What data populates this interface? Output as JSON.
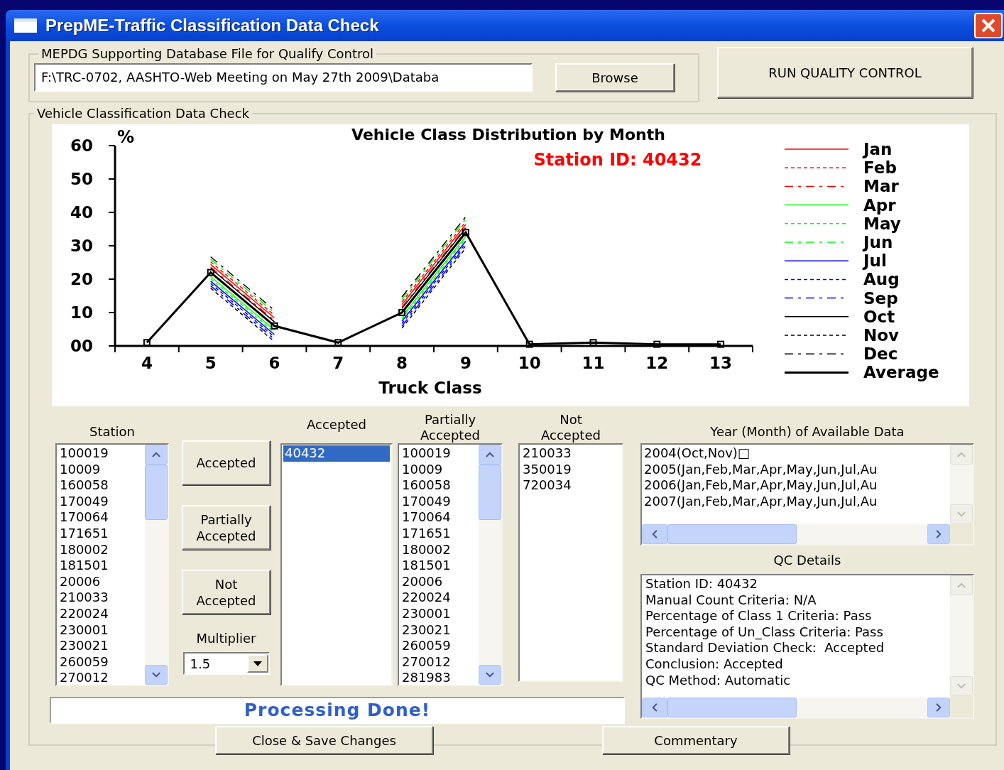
{
  "window": {
    "title": "PrepME-Traffic Classification Data Check"
  },
  "database_group": {
    "legend": "MEPDG Supporting Database File for Qualify Control",
    "file_path": "F:\\TRC-0702, AASHTO-Web Meeting on May 27th 2009\\Databa",
    "browse_button": "Browse"
  },
  "run_button": "RUN QUALITY CONTROL",
  "check_group": {
    "legend": "Vehicle Classification Data Check",
    "chart_data": {
      "type": "line",
      "title": "Vehicle Class Distribution by Month",
      "xlabel": "Truck Class",
      "ylabel": "%",
      "categories": [
        "4",
        "5",
        "6",
        "7",
        "8",
        "9",
        "10",
        "11",
        "12",
        "13"
      ],
      "ylim": [
        0,
        60
      ],
      "yticks": [
        {
          "value": 0,
          "label": "00"
        },
        10,
        20,
        30,
        40,
        50,
        60
      ],
      "annotations": [
        "Station ID: 40432"
      ],
      "legend": true,
      "series": [
        {
          "name": "Jan",
          "color": "#ff0000",
          "line_style": "solid",
          "values": [
            null,
            24.4,
            8.4,
            null,
            12.4,
            36.4,
            null,
            null,
            null,
            null
          ]
        },
        {
          "name": "Feb",
          "color": "#ff0000",
          "line_style": "dotted",
          "values": [
            null,
            25.2,
            9.2,
            null,
            13.2,
            37.2,
            null,
            null,
            null,
            null
          ]
        },
        {
          "name": "Mar",
          "color": "#ff0000",
          "line_style": "dashdot",
          "values": [
            null,
            23.6,
            7.6,
            null,
            11.6,
            35.6,
            null,
            null,
            null,
            null
          ]
        },
        {
          "name": "Apr",
          "color": "#00ff00",
          "line_style": "solid",
          "values": [
            null,
            20.8,
            4.8,
            null,
            8.8,
            32.8,
            null,
            null,
            null,
            null
          ]
        },
        {
          "name": "May",
          "color": "#00ff00",
          "line_style": "dotted",
          "values": [
            null,
            20.1,
            4.1,
            null,
            8.1,
            32.1,
            null,
            null,
            null,
            null
          ]
        },
        {
          "name": "Jun",
          "color": "#00ff00",
          "line_style": "dashdot",
          "values": [
            null,
            26,
            10,
            null,
            14,
            38,
            null,
            null,
            null,
            null
          ]
        },
        {
          "name": "Jul",
          "color": "#0000ff",
          "line_style": "solid",
          "values": [
            null,
            19.4,
            3.4,
            null,
            7.4,
            31.4,
            null,
            null,
            null,
            null
          ]
        },
        {
          "name": "Aug",
          "color": "#0000ff",
          "line_style": "dotted",
          "values": [
            null,
            18.7,
            2.7,
            null,
            6.7,
            30.7,
            null,
            null,
            null,
            null
          ]
        },
        {
          "name": "Sep",
          "color": "#0000ff",
          "line_style": "dashdot",
          "values": [
            null,
            18,
            2,
            null,
            6,
            30,
            null,
            null,
            null,
            null
          ]
        },
        {
          "name": "Oct",
          "color": "#000000",
          "line_style": "solid",
          "values": [
            null,
            23.2,
            7.2,
            null,
            11.2,
            35.2,
            null,
            null,
            null,
            null
          ]
        },
        {
          "name": "Nov",
          "color": "#000000",
          "line_style": "dotted",
          "values": [
            null,
            17.3,
            1.3,
            null,
            5.3,
            29.3,
            null,
            null,
            null,
            null
          ]
        },
        {
          "name": "Dec",
          "color": "#000000",
          "line_style": "dashdot",
          "values": [
            null,
            26.7,
            10.7,
            null,
            14.7,
            38.7,
            null,
            null,
            null,
            null
          ]
        },
        {
          "name": "Average",
          "color": "#000000",
          "line_style": "solid",
          "marker": "square",
          "values": [
            1,
            22,
            6,
            1,
            10,
            34,
            0.5,
            1,
            0.5,
            0.5
          ]
        }
      ]
    },
    "station_list": {
      "label": "Station",
      "items": [
        {
          "text": "100019",
          "selected": false
        },
        {
          "text": "10009",
          "selected": false
        },
        {
          "text": "160058",
          "selected": false
        },
        {
          "text": "170049",
          "selected": false
        },
        {
          "text": "170064",
          "selected": false
        },
        {
          "text": "171651",
          "selected": false
        },
        {
          "text": "180002",
          "selected": false
        },
        {
          "text": "181501",
          "selected": false
        },
        {
          "text": "20006",
          "selected": false
        },
        {
          "text": "210033",
          "selected": false
        },
        {
          "text": "220024",
          "selected": false
        },
        {
          "text": "230001",
          "selected": false
        },
        {
          "text": "230021",
          "selected": false
        },
        {
          "text": "260059",
          "selected": false
        },
        {
          "text": "270012",
          "selected": false
        }
      ]
    },
    "action_buttons": [
      "Accepted",
      "Partially Accepted",
      "Not Accepted"
    ],
    "multiplier": {
      "label": "Multiplier",
      "value": "1.5"
    },
    "accepted_list": {
      "label": "Accepted",
      "items": [
        {
          "text": "40432",
          "selected": true
        }
      ]
    },
    "partially_accepted_list": {
      "label": "Partially Accepted",
      "items": [
        {
          "text": "100019",
          "selected": false
        },
        {
          "text": "10009",
          "selected": false
        },
        {
          "text": "160058",
          "selected": false
        },
        {
          "text": "170049",
          "selected": false
        },
        {
          "text": "170064",
          "selected": false
        },
        {
          "text": "171651",
          "selected": false
        },
        {
          "text": "180002",
          "selected": false
        },
        {
          "text": "181501",
          "selected": false
        },
        {
          "text": "20006",
          "selected": false
        },
        {
          "text": "220024",
          "selected": false
        },
        {
          "text": "230001",
          "selected": false
        },
        {
          "text": "230021",
          "selected": false
        },
        {
          "text": "260059",
          "selected": false
        },
        {
          "text": "270012",
          "selected": false
        },
        {
          "text": "281983",
          "selected": false
        }
      ]
    },
    "not_accepted_list": {
      "label": "Not Accepted",
      "items": [
        {
          "text": "210033",
          "selected": false
        },
        {
          "text": "350019",
          "selected": false
        },
        {
          "text": "720034",
          "selected": false
        }
      ]
    },
    "available_data": {
      "label": "Year (Month) of Available Data",
      "lines": [
        "2004(Oct,Nov)□",
        "2005(Jan,Feb,Mar,Apr,May,Jun,Jul,Au",
        "2006(Jan,Feb,Mar,Apr,May,Jun,Jul,Au",
        "2007(Jan,Feb,Mar,Apr,May,Jun,Jul,Au"
      ]
    },
    "qc_details": {
      "label": "QC Details",
      "lines": [
        "Station ID: 40432",
        "Manual Count Criteria: N/A",
        "Percentage of Class 1 Criteria: Pass",
        "Percentage of Un_Class Criteria: Pass",
        "Standard Deviation Check:  Accepted",
        "Conclusion: Accepted",
        "QC Method: Automatic"
      ]
    },
    "status": "Processing Done!",
    "bottom_buttons": [
      "Close & Save Changes",
      "Commentary"
    ]
  }
}
